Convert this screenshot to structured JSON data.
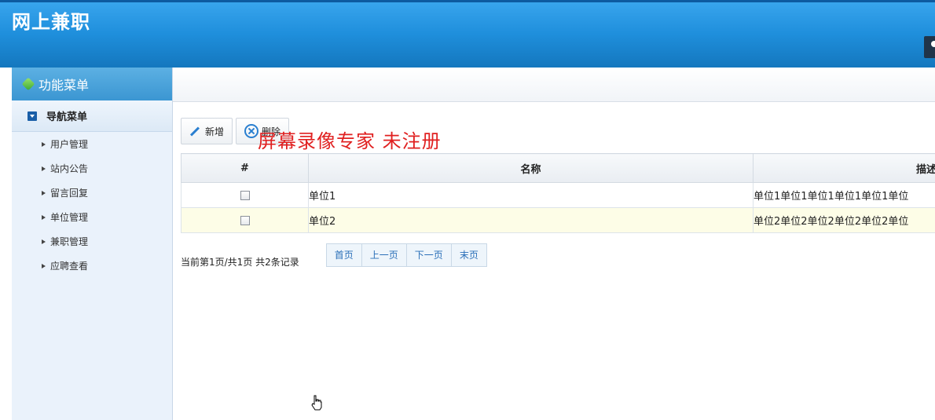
{
  "app": {
    "title": "网上兼职"
  },
  "sidebar": {
    "header": "功能菜单",
    "group": "导航菜单",
    "items": [
      {
        "label": "用户管理"
      },
      {
        "label": "站内公告"
      },
      {
        "label": "留言回复"
      },
      {
        "label": "单位管理"
      },
      {
        "label": "兼职管理"
      },
      {
        "label": "应聘查看"
      }
    ]
  },
  "toolbar": {
    "add_label": "新增",
    "delete_label": "删除"
  },
  "table": {
    "columns": [
      "#",
      "名称",
      "描述"
    ],
    "rows": [
      {
        "name": "单位1",
        "desc": "单位1单位1单位1单位1单位1单位"
      },
      {
        "name": "单位2",
        "desc": "单位2单位2单位2单位2单位2单位"
      }
    ]
  },
  "watermark": "屏幕录像专家  未注册",
  "pager": {
    "info": "当前第1页/共1页  共2条记录",
    "first": "首页",
    "prev": "上一页",
    "next": "下一页",
    "last": "末页"
  },
  "icons": [
    "gem-icon",
    "expand-box-icon",
    "arrow-right-icon",
    "pencil-icon",
    "x-circle-icon",
    "checkbox-icon",
    "hand-cursor-icon"
  ]
}
